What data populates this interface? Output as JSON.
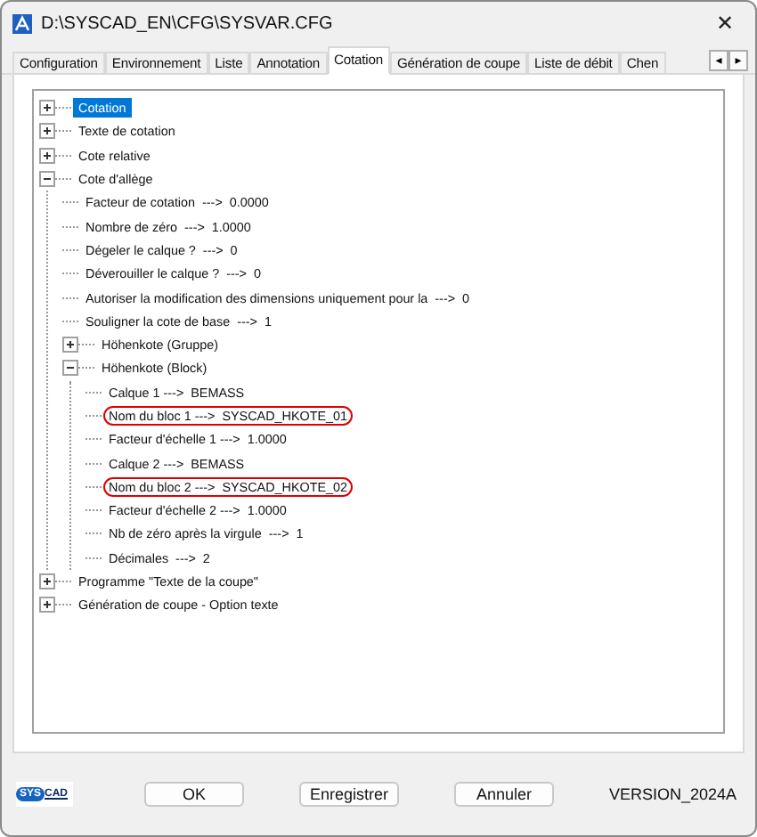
{
  "window": {
    "title": "D:\\SYSCAD_EN\\CFG\\SYSVAR.CFG",
    "close": "✕"
  },
  "tabs": [
    {
      "label": "Configuration",
      "selected": false
    },
    {
      "label": "Environnement",
      "selected": false
    },
    {
      "label": "Liste",
      "selected": false
    },
    {
      "label": "Annotation",
      "selected": false
    },
    {
      "label": "Cotation",
      "selected": true
    },
    {
      "label": "Génération de coupe",
      "selected": false
    },
    {
      "label": "Liste de débit",
      "selected": false
    },
    {
      "label": "Chen",
      "selected": false
    }
  ],
  "tab_scroll": [
    "◂",
    "▸"
  ],
  "tree": [
    {
      "label": "Cotation",
      "expanded": false,
      "selected": true,
      "highlighted": false
    },
    {
      "label": "Texte de cotation",
      "expanded": false,
      "selected": false,
      "highlighted": false
    },
    {
      "label": "Cote relative",
      "expanded": false,
      "selected": false,
      "highlighted": false
    },
    {
      "label": "Cote d'allège",
      "expanded": true,
      "selected": false,
      "highlighted": false,
      "children": [
        {
          "label": "Facteur de cotation  --->  0.0000",
          "selected": false,
          "highlighted": false
        },
        {
          "label": "Nombre de zéro  --->  1.0000",
          "selected": false,
          "highlighted": false
        },
        {
          "label": "Dégeler le calque ?  --->  0",
          "selected": false,
          "highlighted": false
        },
        {
          "label": "Déverouiller le calque ?  --->  0",
          "selected": false,
          "highlighted": false
        },
        {
          "label": "Autoriser la modification des dimensions uniquement pour la  --->  0",
          "selected": false,
          "highlighted": false
        },
        {
          "label": "Souligner la cote de base  --->  1",
          "selected": false,
          "highlighted": false
        },
        {
          "label": "Höhenkote (Gruppe)",
          "expanded": false,
          "selected": false,
          "highlighted": false
        },
        {
          "label": "Höhenkote (Block)",
          "expanded": true,
          "selected": false,
          "highlighted": false,
          "children": [
            {
              "label": "Calque 1 --->  BEMASS",
              "selected": false,
              "highlighted": false
            },
            {
              "label": "Nom du bloc 1 --->  SYSCAD_HKOTE_01",
              "selected": false,
              "highlighted": true
            },
            {
              "label": "Facteur d'échelle 1 --->  1.0000",
              "selected": false,
              "highlighted": false
            },
            {
              "label": "Calque 2 --->  BEMASS",
              "selected": false,
              "highlighted": false
            },
            {
              "label": "Nom du bloc 2 --->  SYSCAD_HKOTE_02",
              "selected": false,
              "highlighted": true
            },
            {
              "label": "Facteur d'échelle 2 --->  1.0000",
              "selected": false,
              "highlighted": false
            },
            {
              "label": "Nb de zéro après la virgule  --->  1",
              "selected": false,
              "highlighted": false
            },
            {
              "label": "Décimales  --->  2",
              "selected": false,
              "highlighted": false
            }
          ]
        }
      ]
    },
    {
      "label": "Programme \"Texte de la coupe\"",
      "expanded": false,
      "selected": false,
      "highlighted": false
    },
    {
      "label": "Génération de coupe - Option texte",
      "expanded": false,
      "selected": false,
      "highlighted": false
    }
  ],
  "logo": {
    "left": "SYS",
    "right": "CAD"
  },
  "buttons": [
    "OK",
    "Enregistrer",
    "Annuler"
  ],
  "version": "VERSION_2024A"
}
